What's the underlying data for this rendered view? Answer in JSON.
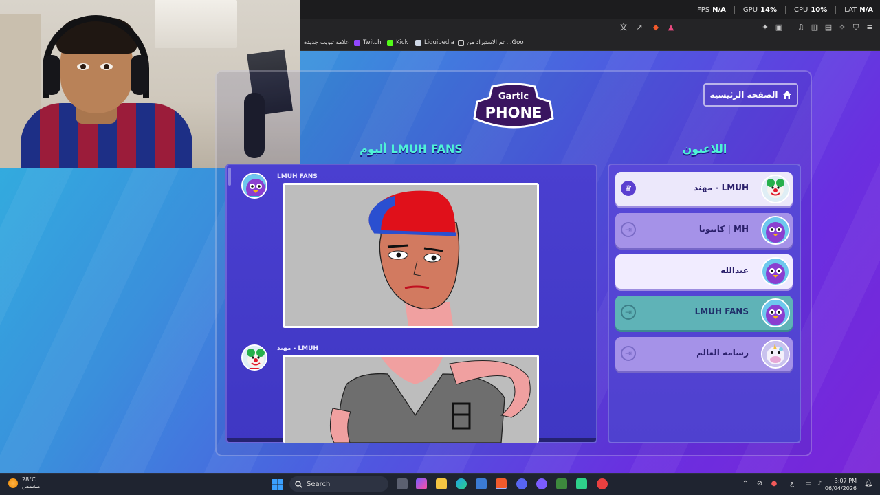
{
  "perf": {
    "fps_label": "FPS",
    "fps_value": "N/A",
    "gpu_label": "GPU",
    "gpu_value": "14%",
    "cpu_label": "CPU",
    "cpu_value": "10%",
    "lat_label": "LAT",
    "lat_value": "N/A"
  },
  "bookmarks": [
    {
      "label": "علامة تبويب جديدة",
      "icon": "new-tab-icon"
    },
    {
      "label": "Twitch",
      "icon": "twitch-icon",
      "color": "#9146ff"
    },
    {
      "label": "Kick",
      "icon": "kick-icon",
      "color": "#53fc18"
    },
    {
      "label": "Liquipedia",
      "icon": "liquipedia-icon"
    },
    {
      "label": "تم الاستيراد من ...Goo",
      "icon": "folder-icon"
    }
  ],
  "game": {
    "logo_top": "Gartic",
    "logo_bottom": "PHONE",
    "home_button": "الصفحة الرئيسية",
    "album_title": "ألبوم LMUH FANS",
    "players_title": "اللاعبون",
    "album_entries": [
      {
        "author": "LMUH FANS",
        "avatar": "purple-bird-avatar"
      },
      {
        "author": "مهند - LMUH",
        "avatar": "clown-avatar"
      }
    ],
    "players": [
      {
        "name": "مهند - LMUH",
        "avatar": "clown-avatar",
        "state": "host",
        "left_icon": "crown-icon"
      },
      {
        "name": "كانتونا | MH",
        "avatar": "purple-bird-avatar",
        "state": "done",
        "left_icon": "exit-icon"
      },
      {
        "name": "عبدالله",
        "avatar": "purple-bird-avatar",
        "state": "active",
        "left_icon": ""
      },
      {
        "name": "LMUH FANS",
        "avatar": "purple-bird-avatar",
        "state": "current",
        "left_icon": "exit-icon"
      },
      {
        "name": "رسامه العالم",
        "avatar": "cow-avatar",
        "state": "done",
        "left_icon": "exit-icon"
      }
    ]
  },
  "taskbar": {
    "weather_temp": "28°C",
    "weather_text": "مشمس",
    "search_placeholder": "Search",
    "time": "3:07 PM",
    "date": "06/04/2026",
    "lang": "ع"
  },
  "colors": {
    "accent_teal": "#4ef2d6",
    "player_current": "#5fb3b7",
    "player_active": "#f1ecff",
    "player_done": "#a592e8"
  }
}
